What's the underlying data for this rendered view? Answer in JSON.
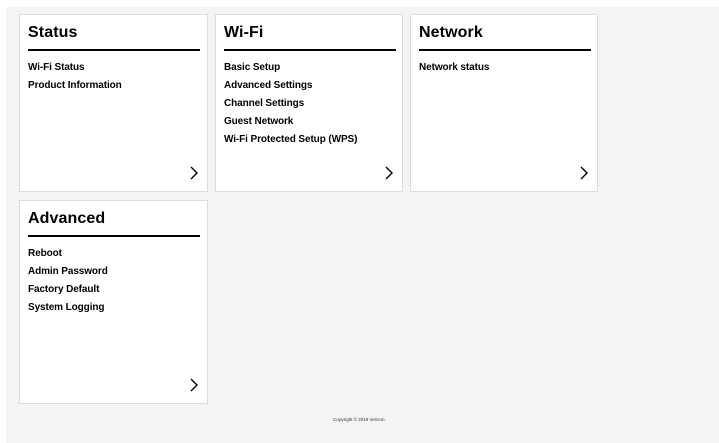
{
  "cards": [
    {
      "title": "Status",
      "links": [
        "Wi-Fi Status",
        "Product Information"
      ]
    },
    {
      "title": "Wi-Fi",
      "links": [
        "Basic Setup",
        "Advanced Settings",
        "Channel Settings",
        "Guest Network",
        "Wi-Fi Protected Setup (WPS)"
      ]
    },
    {
      "title": "Network",
      "links": [
        "Network status"
      ]
    },
    {
      "title": "Advanced",
      "links": [
        "Reboot",
        "Admin Password",
        "Factory Default",
        "System Logging"
      ]
    }
  ],
  "icons": {
    "chevron": "chevron-right-icon"
  },
  "footer": {
    "copyright": "Copyright © 2019 Verizon."
  },
  "colors": {
    "background": "#f4f4f4",
    "card": "#ffffff",
    "text": "#000000"
  }
}
